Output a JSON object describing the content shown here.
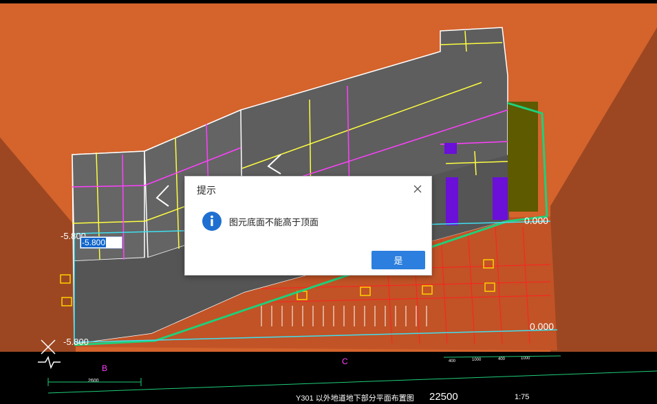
{
  "dialog": {
    "title": "提示",
    "message": "图元底面不能高于顶面",
    "confirm_label": "是",
    "accent": "#2c7fde"
  },
  "canvas": {
    "elevation_input_value": "-5.800",
    "elevation_labels": {
      "left_top": "-5.800",
      "left_bottom": "-5.800",
      "right_top": "0.000",
      "right_bottom": "0.000"
    },
    "axis_labels": {
      "b": "B",
      "c": "C"
    },
    "dimensions": {
      "d2600": "2600",
      "d22500": "22500",
      "scale": "1:75",
      "d1000": "1000",
      "d400": "400",
      "d400b": "400",
      "d1000b": "1000"
    },
    "drawing_title": "Y301 以外地道地下部分平面布置图",
    "colors": {
      "wall": "#d4632c",
      "slab": "#5e5e5e",
      "outline_green": "#1fd07a"
    }
  }
}
